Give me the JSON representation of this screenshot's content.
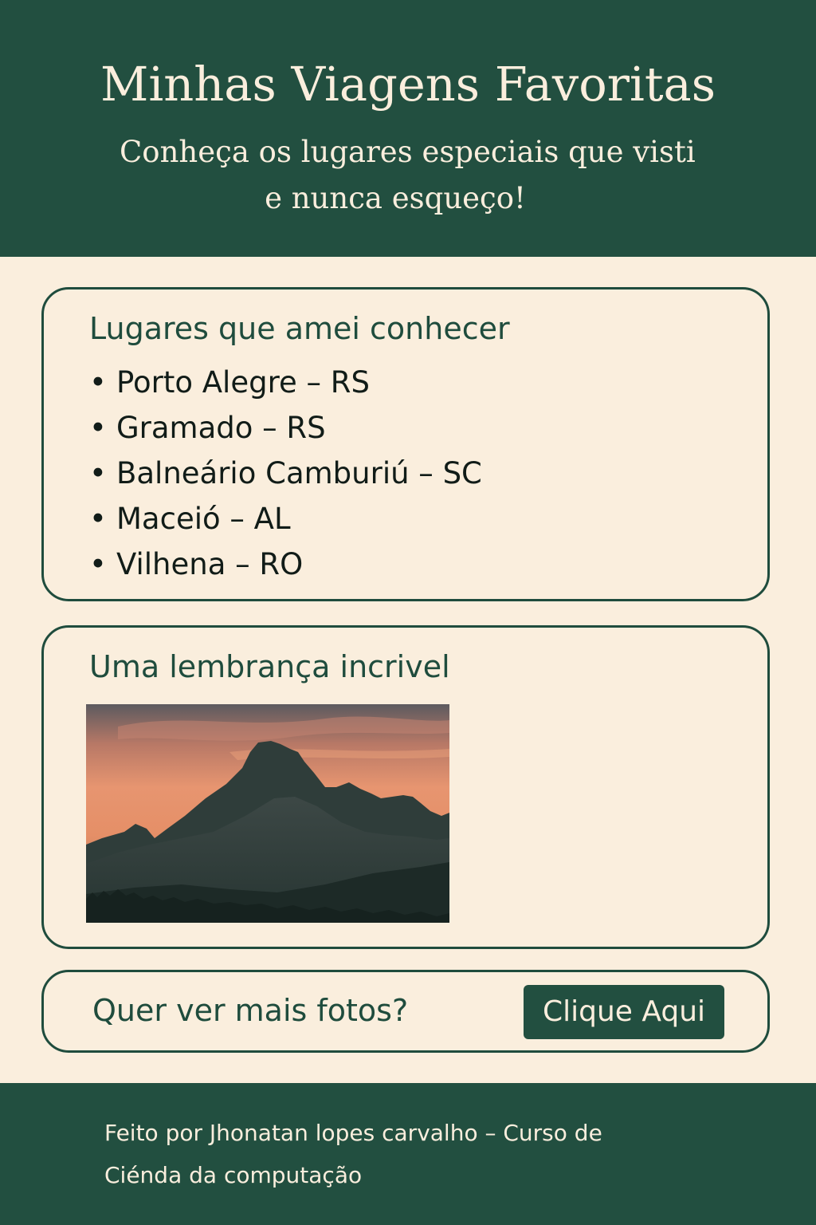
{
  "header": {
    "title": "Minhas Viagens Favoritas",
    "subtitle_line1": "Conheça os lugares especiais que visti",
    "subtitle_line2": "e nunca esqueço!"
  },
  "places": {
    "heading": "Lugares que amei conhecer",
    "bullet": "•",
    "items": [
      "Porto Alegre – RS",
      "Gramado – RS",
      "Balneário Camburiú – SC",
      "Maceió – AL",
      "Vilhena – RO"
    ]
  },
  "memory": {
    "heading": "Uma lembrança incrivel"
  },
  "cta": {
    "text": "Quer ver mais fotos?",
    "button_label": "Clique Aqui"
  },
  "footer": {
    "text": "Feito por Jhonatan lopes carvalho – Curso de Ciénda da computação"
  },
  "colors": {
    "primary": "#224f40",
    "background": "#faeedd",
    "text_dark": "#111c18"
  }
}
